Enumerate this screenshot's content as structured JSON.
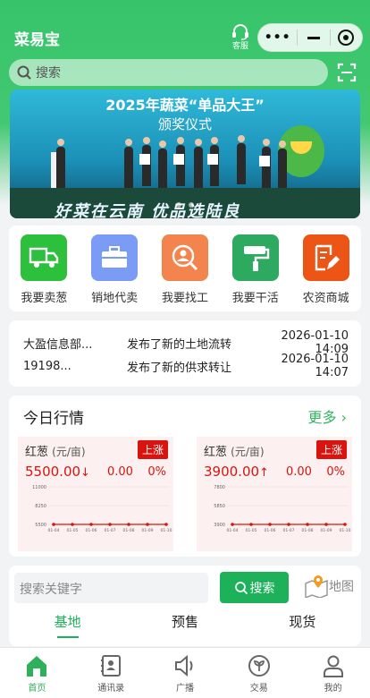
{
  "app": {
    "title": "菜易宝"
  },
  "header": {
    "service_label": "客服",
    "search_placeholder": "搜索"
  },
  "banner": {
    "line1": "2025年蔬菜“单品大王”",
    "line2": "颁奖仪式",
    "slogan": "好菜在云南 优品选陆良"
  },
  "menu": [
    {
      "label": "我要卖葱",
      "color": "#2dc03c",
      "icon": "truck-icon"
    },
    {
      "label": "销地代卖",
      "color": "#7a9cf5",
      "icon": "briefcase-icon"
    },
    {
      "label": "我要找工",
      "color": "#f4844d",
      "icon": "search-person-icon"
    },
    {
      "label": "我要干活",
      "color": "#2daa60",
      "icon": "paint-roller-icon"
    },
    {
      "label": "农资商城",
      "color": "#ec5515",
      "icon": "edit-document-icon"
    }
  ],
  "news": [
    {
      "who": "大盈信息部...",
      "what": "发布了新的土地流转",
      "time": "2026-01-10 14:09"
    },
    {
      "who": "19198...",
      "what": "发布了新的供求转让",
      "time": "2026-01-10 14:07"
    }
  ],
  "market": {
    "title": "今日行情",
    "more": "更多",
    "cards": [
      {
        "name": "红葱",
        "unit": "(元/亩)",
        "badge": "上涨",
        "price": "5500.00",
        "arrow": "↓",
        "change": "0.00",
        "pct": "0%"
      },
      {
        "name": "红葱",
        "unit": "(元/亩)",
        "badge": "上涨",
        "price": "3900.00",
        "arrow": "↑",
        "change": "0.00",
        "pct": "0%"
      }
    ]
  },
  "chart_data": [
    {
      "type": "line",
      "x": [
        "01-04",
        "01-05",
        "01-06",
        "01-07",
        "01-08",
        "01-09",
        "01-10"
      ],
      "y_ticks": [
        "11000",
        "8250",
        "5500"
      ],
      "ylim": [
        5500,
        11000
      ],
      "series": [
        {
          "values": [
            5500,
            5500,
            5500,
            5500,
            5500,
            5500,
            5500
          ]
        }
      ],
      "color": "#d9140f"
    },
    {
      "type": "line",
      "x": [
        "01-04",
        "01-05",
        "01-06",
        "01-07",
        "01-08",
        "01-09",
        "01-10"
      ],
      "y_ticks": [
        "7800",
        "5850",
        "3900"
      ],
      "ylim": [
        3900,
        7800
      ],
      "series": [
        {
          "values": [
            3900,
            3900,
            3900,
            3900,
            3900,
            3900,
            3900
          ]
        }
      ],
      "color": "#d9140f"
    }
  ],
  "listing": {
    "keyword_placeholder": "搜索关键字",
    "search_label": "搜索",
    "map_label": "地图",
    "tabs": [
      "基地",
      "预售",
      "现货"
    ]
  },
  "tabbar": [
    {
      "label": "首页",
      "icon": "home-icon"
    },
    {
      "label": "通讯录",
      "icon": "contacts-icon"
    },
    {
      "label": "广播",
      "icon": "speaker-icon"
    },
    {
      "label": "交易",
      "icon": "trade-icon"
    },
    {
      "label": "我的",
      "icon": "profile-icon"
    }
  ]
}
